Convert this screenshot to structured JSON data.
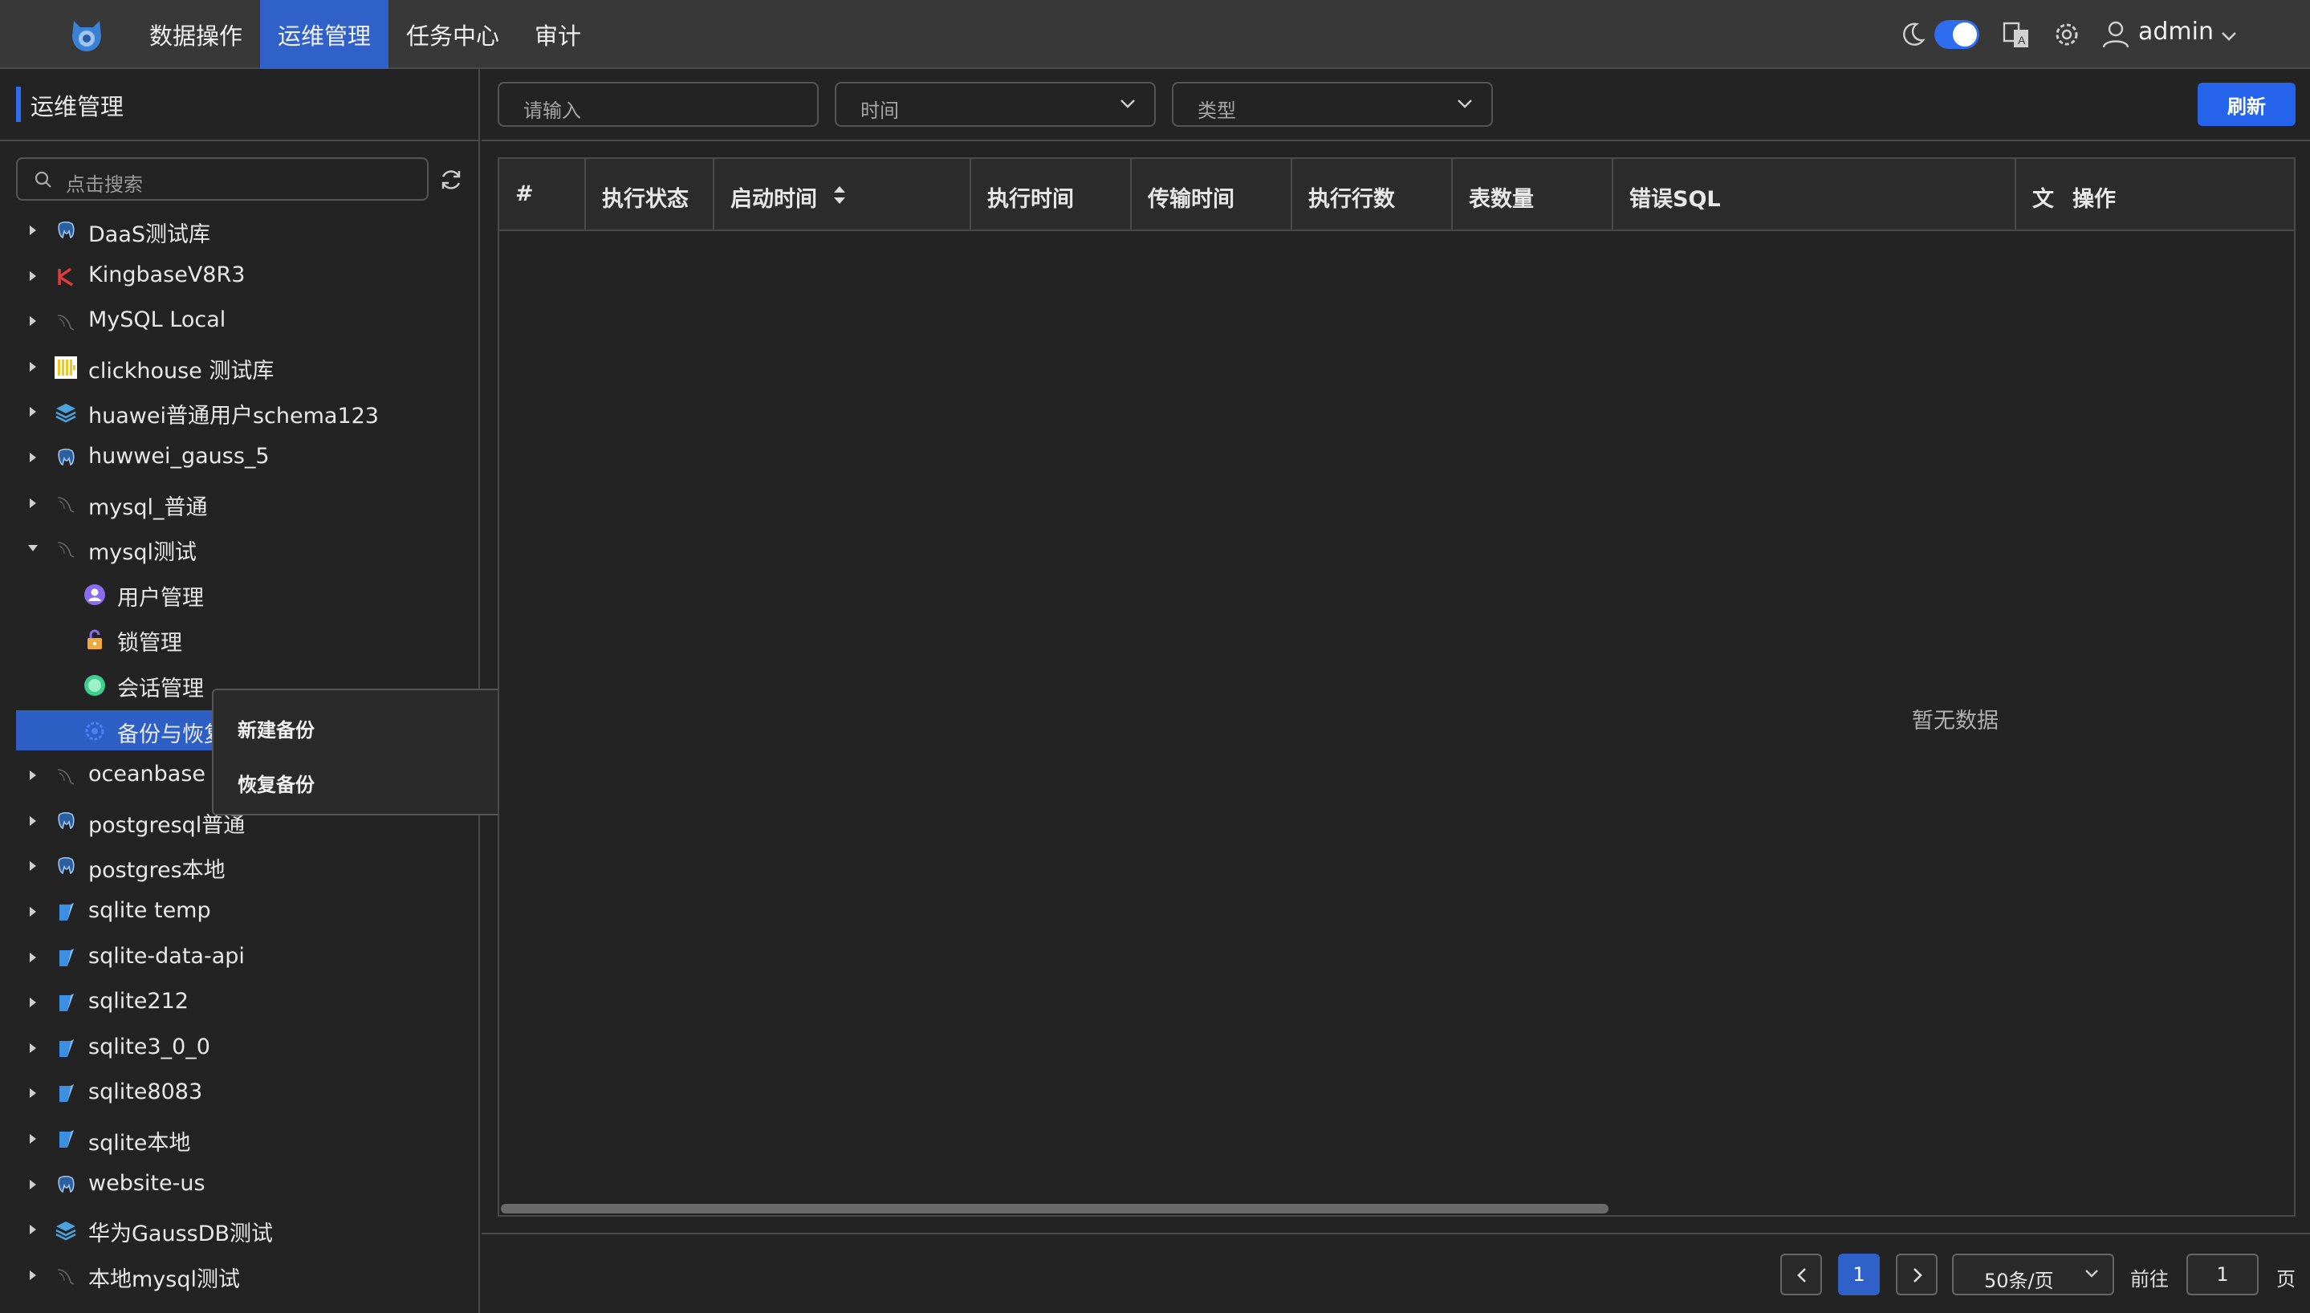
{
  "nav": {
    "items": [
      "数据操作",
      "运维管理",
      "任务中心",
      "审计"
    ],
    "active_index": 1
  },
  "user": {
    "name": "admin"
  },
  "sidebar": {
    "title": "运维管理",
    "search_placeholder": "点击搜索",
    "tree": [
      {
        "label": "DaaS测试库",
        "icon": "postgres-icon"
      },
      {
        "label": "KingbaseV8R3",
        "icon": "kingbase-icon"
      },
      {
        "label": "MySQL Local",
        "icon": "mysql-icon"
      },
      {
        "label": "clickhouse 测试库",
        "icon": "clickhouse-icon"
      },
      {
        "label": "huawei普通用户schema123",
        "icon": "gauss-icon"
      },
      {
        "label": "huwwei_gauss_5",
        "icon": "postgres-icon"
      },
      {
        "label": "mysql_普通",
        "icon": "mysql-icon"
      },
      {
        "label": "mysql测试",
        "icon": "mysql-icon",
        "expanded": true
      },
      {
        "label": "用户管理",
        "icon": "user-manage-icon",
        "child": true
      },
      {
        "label": "锁管理",
        "icon": "lock-icon",
        "child": true
      },
      {
        "label": "会话管理",
        "icon": "session-icon",
        "child": true
      },
      {
        "label": "备份与恢复",
        "icon": "backup-icon",
        "child": true,
        "selected": true
      },
      {
        "label": "oceanbase",
        "icon": "mysql-icon"
      },
      {
        "label": "postgresql普通",
        "icon": "postgres-icon"
      },
      {
        "label": "postgres本地",
        "icon": "postgres-icon"
      },
      {
        "label": "sqlite temp",
        "icon": "sqlite-icon"
      },
      {
        "label": "sqlite-data-api",
        "icon": "sqlite-icon"
      },
      {
        "label": "sqlite212",
        "icon": "sqlite-icon"
      },
      {
        "label": "sqlite3_0_0",
        "icon": "sqlite-icon"
      },
      {
        "label": "sqlite8083",
        "icon": "sqlite-icon"
      },
      {
        "label": "sqlite本地",
        "icon": "sqlite-icon"
      },
      {
        "label": "website-us",
        "icon": "postgres-icon"
      },
      {
        "label": "华为GaussDB测试",
        "icon": "gauss-icon"
      },
      {
        "label": "本地mysql测试",
        "icon": "mysql-icon"
      }
    ]
  },
  "context_menu": {
    "items": [
      "新建备份",
      "恢复备份"
    ]
  },
  "filters": {
    "keyword_placeholder": "请输入",
    "time_placeholder": "时间",
    "type_placeholder": "类型",
    "refresh_label": "刷新"
  },
  "table": {
    "columns": [
      "#",
      "执行状态",
      "启动时间",
      "执行时间",
      "传输时间",
      "执行行数",
      "表数量",
      "错误SQL",
      "文",
      "操作"
    ],
    "empty_text": "暂无数据"
  },
  "pagination": {
    "current_page": "1",
    "page_size": "50条/页",
    "goto_label": "前往",
    "goto_value": "1",
    "page_suffix": "页"
  },
  "colors": {
    "accent": "#2f61c8",
    "button": "#2563eb",
    "background": "#232323",
    "topbar": "#383838"
  }
}
